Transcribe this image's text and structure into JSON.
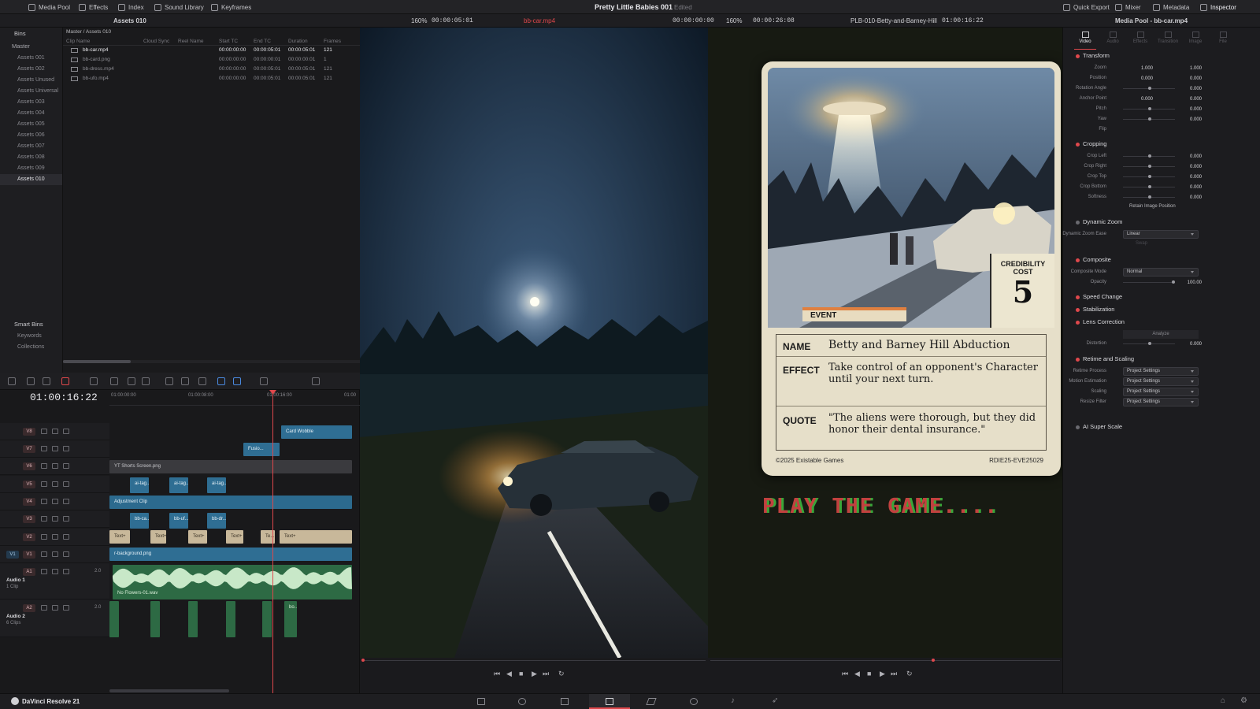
{
  "app": {
    "name": "DaVinci Resolve 21",
    "project_title": "Pretty Little Babies 001",
    "project_status": "Edited"
  },
  "topbar": {
    "left": [
      "Media Pool",
      "Effects",
      "Index",
      "Sound Library",
      "Keyframes"
    ],
    "right": [
      "Quick Export",
      "Mixer",
      "Metadata",
      "Inspector"
    ]
  },
  "media_pool": {
    "bin_title": "Assets 010",
    "path": "Master / Assets 010",
    "bins_header": "Bins",
    "master_label": "Master",
    "bins": [
      "Assets 001",
      "Assets 002",
      "Assets Unused",
      "Assets Universal",
      "Assets 003",
      "Assets 004",
      "Assets 005",
      "Assets 006",
      "Assets 007",
      "Assets 008",
      "Assets 009",
      "Assets 010"
    ],
    "smart_bins_header": "Smart Bins",
    "smart_bins": [
      "Keywords",
      "Collections"
    ],
    "columns": [
      "Clip Name",
      "Cloud Sync",
      "Reel Name",
      "Start TC",
      "End TC",
      "Duration",
      "Frames"
    ],
    "clips": [
      {
        "name": "bb-car.mp4",
        "start": "00:00:00:00",
        "end": "00:00:05:01",
        "duration": "00:00:05:01",
        "frames": "121"
      },
      {
        "name": "bb-card.png",
        "start": "00:00:00:00",
        "end": "00:00:00:01",
        "duration": "00:00:00:01",
        "frames": "1"
      },
      {
        "name": "bb-dress.mp4",
        "start": "00:00:00:00",
        "end": "00:00:05:01",
        "duration": "00:00:05:01",
        "frames": "121"
      },
      {
        "name": "bb-ufo.mp4",
        "start": "00:00:00:00",
        "end": "00:00:05:01",
        "duration": "00:00:05:01",
        "frames": "121"
      }
    ]
  },
  "source_viewer": {
    "zoom": "160%",
    "timecode": "00:00:05:01",
    "clip_name": "bb-car.mp4",
    "position_tc": "00:00:00:00"
  },
  "timeline_viewer": {
    "zoom": "160%",
    "duration_tc": "00:00:26:08",
    "timeline_name": "PLB-010-Betty-and-Barney-Hill",
    "timecode": "01:00:16:22"
  },
  "card": {
    "credibility_label": "CREDIBILITY COST",
    "cost": "5",
    "type": "EVENT",
    "name_label": "NAME",
    "name_value": "Betty and Barney Hill Abduction",
    "effect_label": "EFFECT",
    "effect_value": "Take control of an opponent's Character until your next turn.",
    "quote_label": "QUOTE",
    "quote_value": "\"The aliens were thorough, but they did honor their dental insurance.\"",
    "copyright": "©2025 Existable Games",
    "code": "RDIE25-EVE25029",
    "overlay_text": "PLAY THE GAME...."
  },
  "timeline": {
    "timecode": "01:00:16:22",
    "ruler": [
      "01:00:00:00",
      "01:00:08:00",
      "01:00:16:00",
      "01:00"
    ],
    "tracks": [
      "V8",
      "V7",
      "V6",
      "V5",
      "V4",
      "V3",
      "V2",
      "V1",
      "A1",
      "A2"
    ],
    "audio1_name": "Audio 1",
    "audio1_count": "1 Clip",
    "audio2_name": "Audio 2",
    "audio2_count": "6 Clips",
    "audio_level": "2.0",
    "clips": {
      "card_wobble": "Card Wobble",
      "fusion": "Fusio...",
      "yt_shorts": "YT Shorts Screen.png",
      "ai_tag": "ai-tag...",
      "adjustment": "Adjustment Clip",
      "bb_ca": "bb-ca...",
      "bb_uf": "bb-uf...",
      "bb_dr": "bb-dr...",
      "text": "Text+",
      "text_short": "Te...",
      "background": "r-background.png",
      "audio1": "No Flowers-01.wav",
      "audio2_small": "bo..."
    }
  },
  "inspector": {
    "title": "Media Pool - bb-car.mp4",
    "tabs": [
      "Video",
      "Audio",
      "Effects",
      "Transition",
      "Image",
      "File"
    ],
    "transform": {
      "label": "Transform",
      "zoom_label": "Zoom",
      "zoom_x": "1.000",
      "zoom_y": "1.000",
      "position_label": "Position",
      "pos_x": "0.000",
      "pos_y": "0.000",
      "rotation_label": "Rotation Angle",
      "rotation": "0.000",
      "anchor_label": "Anchor Point",
      "anchor_x": "0.000",
      "anchor_y": "0.000",
      "pitch_label": "Pitch",
      "pitch": "0.000",
      "yaw_label": "Yaw",
      "yaw": "0.000",
      "flip_label": "Flip"
    },
    "cropping": {
      "label": "Cropping",
      "left_label": "Crop Left",
      "left": "0.000",
      "right_label": "Crop Right",
      "right": "0.000",
      "top_label": "Crop Top",
      "top": "0.000",
      "bottom_label": "Crop Bottom",
      "bottom": "0.000",
      "softness_label": "Softness",
      "softness": "0.000",
      "retain_label": "Retain Image Position"
    },
    "dynamic_zoom": {
      "label": "Dynamic Zoom",
      "ease_label": "Dynamic Zoom Ease",
      "ease": "Linear",
      "swap": "Swap"
    },
    "composite": {
      "label": "Composite",
      "mode_label": "Composite Mode",
      "mode": "Normal",
      "opacity_label": "Opacity",
      "opacity": "100.00"
    },
    "speed_change": "Speed Change",
    "stabilization": "Stabilization",
    "lens": {
      "label": "Lens Correction",
      "analyze": "Analyze",
      "distortion_label": "Distortion",
      "distortion": "0.000"
    },
    "retime": {
      "label": "Retime and Scaling",
      "process_label": "Retime Process",
      "process": "Project Settings",
      "motion_label": "Motion Estimation",
      "motion": "Project Settings",
      "scaling_label": "Scaling",
      "scaling": "Project Settings",
      "resize_label": "Resize Filter",
      "resize": "Project Settings"
    },
    "super_scale": "AI Super Scale"
  }
}
